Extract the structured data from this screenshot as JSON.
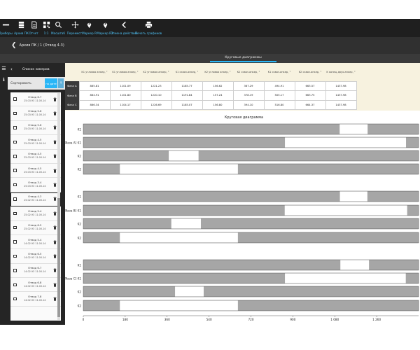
{
  "toolbar": {
    "buttons": [
      {
        "label": "Приборы",
        "icon": "minus-icon"
      },
      {
        "label": "Архив ПК",
        "icon": "database-icon"
      },
      {
        "label": "Отчет",
        "icon": "document-icon"
      },
      {
        "label": "1:1",
        "icon": "qr-icon"
      },
      {
        "label": "Масштаб",
        "icon": "search-icon"
      },
      {
        "label": "Перемест.",
        "icon": "move-icon"
      },
      {
        "label": "Маркер R",
        "icon": "pin-icon"
      },
      {
        "label": "Маркер R2",
        "icon": "pin-icon"
      },
      {
        "label": "Отмена действия",
        "icon": "chevron-left-icon"
      },
      {
        "label": "Печать графиков",
        "icon": "printer-icon"
      }
    ]
  },
  "breadcrumb": {
    "text": "Архив ПК / 1 (Отвод 4-3)"
  },
  "tabs": {
    "active": "Круговые диаграммы"
  },
  "sidebar": {
    "title": "Список замеров",
    "sort_label": "Сортировать",
    "sort_button": "по дате",
    "measurements": [
      {
        "name": "Отвод 6-7",
        "date": "25.03.93 11.00.14",
        "selected": false
      },
      {
        "name": "Отвод 5-6",
        "date": "25.03.93 11.00.14",
        "selected": false
      },
      {
        "name": "Отвод 5-6",
        "date": "25.03.93 11.00.14",
        "selected": false
      },
      {
        "name": "Отвод 4-5",
        "date": "25.03.93 11.00.14",
        "selected": false
      },
      {
        "name": "Отвод 4-5",
        "date": "25.03.93 11.00.14",
        "selected": false
      },
      {
        "name": "Отвод 4-5",
        "date": "25.03.93 11.00.14",
        "selected": false
      },
      {
        "name": "Отвод 3-4",
        "date": "25.03.93 11.00.14",
        "selected": false
      },
      {
        "name": "Отвод 4-3",
        "date": "25.02.93 11.00.14",
        "selected": true
      },
      {
        "name": "Отвод 5-4",
        "date": "25.02.93 11.00.14",
        "selected": false
      },
      {
        "name": "Отвод 6-5",
        "date": "25.02.93 11.00.14",
        "selected": false
      },
      {
        "name": "Отвод 5-4",
        "date": "14.02.93 11.00.14",
        "selected": false
      },
      {
        "name": "Отвод 6-5",
        "date": "14.02.93 11.00.14",
        "selected": false
      },
      {
        "name": "Отвод 6-7",
        "date": "14.02.93 11.00.14",
        "selected": false
      },
      {
        "name": "Отвод 6-8",
        "date": "14.02.93 11.00.14",
        "selected": false
      },
      {
        "name": "Отвод 7-8",
        "date": "14.02.93 11.00.14",
        "selected": false
      }
    ]
  },
  "table": {
    "headers": [
      "K1 угловая анкер, °",
      "K1 угловая анкер, °",
      "K2 угловая анкер, °",
      "K1 сквоз.анкер, °",
      "K2 угловая анкер, °",
      "K2 сквоз.анкер, °",
      "K1 сквоз.анкер, °",
      "K2 сквоз.анкер, °",
      "K конец двух.анкер, °"
    ],
    "rows": [
      {
        "label": "Фаза А",
        "values": [
          "865.81",
          "1101.09",
          "1221.23",
          "1185.77",
          "156.62",
          "367.29",
          "494.91",
          "663.57",
          "1437.98"
        ]
      },
      {
        "label": "Фаза В",
        "values": [
          "864.91",
          "1101.80",
          "1220.10",
          "1191.84",
          "157.24",
          "378.19",
          "505.17",
          "663.75",
          "1437.98"
        ]
      },
      {
        "label": "Фаза С",
        "values": [
          "866.34",
          "1104.17",
          "1226.69",
          "1185.07",
          "156.80",
          "394.10",
          "516.80",
          "664.37",
          "1437.98"
        ]
      }
    ]
  },
  "chart_data": {
    "type": "bar",
    "title": "Круговая диаграмма",
    "xlim": [
      0,
      1440
    ],
    "xticks": [
      "0",
      "180",
      "360",
      "540",
      "720",
      "900",
      "1 080",
      "1 260"
    ],
    "colors": {
      "fill": "#a6a6a6",
      "gap": "#ffffff",
      "stroke": "#333333"
    },
    "groups": [
      {
        "label": "[Фаза А]",
        "rows": [
          {
            "label": "K1",
            "gaps": [
              [
                1101,
                1221
              ]
            ]
          },
          {
            "label": "K1",
            "gaps": [
              [
                866,
                1386
              ]
            ]
          },
          {
            "label": "K2",
            "gaps": [
              [
                367,
                495
              ]
            ]
          },
          {
            "label": "K2",
            "gaps": [
              [
                157,
                664
              ]
            ]
          }
        ]
      },
      {
        "label": "[Фаза В]",
        "rows": [
          {
            "label": "K1",
            "gaps": [
              [
                1102,
                1220
              ]
            ]
          },
          {
            "label": "K1",
            "gaps": [
              [
                865,
                1391
              ]
            ]
          },
          {
            "label": "K2",
            "gaps": [
              [
                378,
                505
              ]
            ]
          },
          {
            "label": "K2",
            "gaps": [
              [
                157,
                664
              ]
            ]
          }
        ]
      },
      {
        "label": "[Фаза С]",
        "rows": [
          {
            "label": "K1",
            "gaps": [
              [
                1104,
                1227
              ]
            ]
          },
          {
            "label": "K1",
            "gaps": [
              [
                866,
                1385
              ]
            ]
          },
          {
            "label": "K2",
            "gaps": [
              [
                394,
                517
              ]
            ]
          },
          {
            "label": "K2",
            "gaps": [
              [
                157,
                664
              ]
            ]
          }
        ]
      }
    ]
  }
}
